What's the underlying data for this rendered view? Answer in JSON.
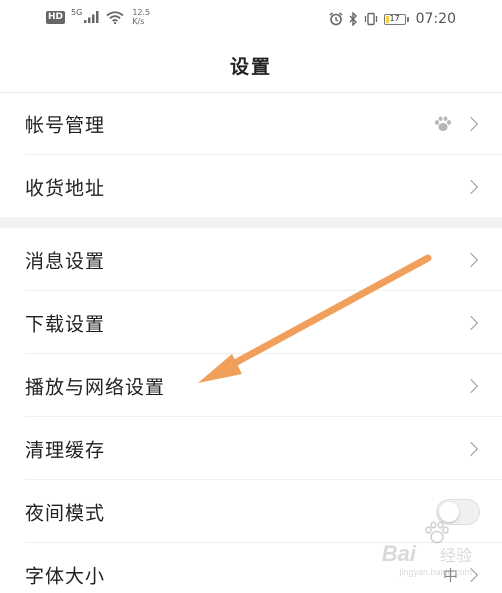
{
  "status_bar": {
    "hd_badge": "HD",
    "network_type": "5G",
    "speed_value": "12.5",
    "speed_unit": "K/s",
    "battery_level": "17",
    "battery_fraction": 0.17,
    "time": "07:20",
    "icons": [
      "signal-icon",
      "wifi-icon",
      "alarm-icon",
      "bluetooth-icon",
      "vibrate-icon",
      "battery-icon"
    ]
  },
  "header": {
    "title": "设置"
  },
  "sections": [
    {
      "items": [
        {
          "label": "帐号管理",
          "accessory": "paw-icon",
          "chevron": true
        },
        {
          "label": "收货地址",
          "chevron": true
        }
      ]
    },
    {
      "items": [
        {
          "label": "消息设置",
          "chevron": true
        },
        {
          "label": "下载设置",
          "chevron": true
        },
        {
          "label": "播放与网络设置",
          "chevron": true
        },
        {
          "label": "清理缓存",
          "chevron": true
        },
        {
          "label": "夜间模式",
          "toggle": false
        },
        {
          "label": "字体大小",
          "value": "中",
          "chevron": true
        }
      ]
    }
  ],
  "annotation": {
    "color": "#f0a05a"
  },
  "watermark": {
    "brand": "Bai",
    "brand_suffix": "经验",
    "url": "jingyan.baidu.com"
  },
  "colors": {
    "text": "#222222",
    "chevron": "#999999",
    "separator": "#efefef",
    "section_gap": "#f2f2f2"
  }
}
